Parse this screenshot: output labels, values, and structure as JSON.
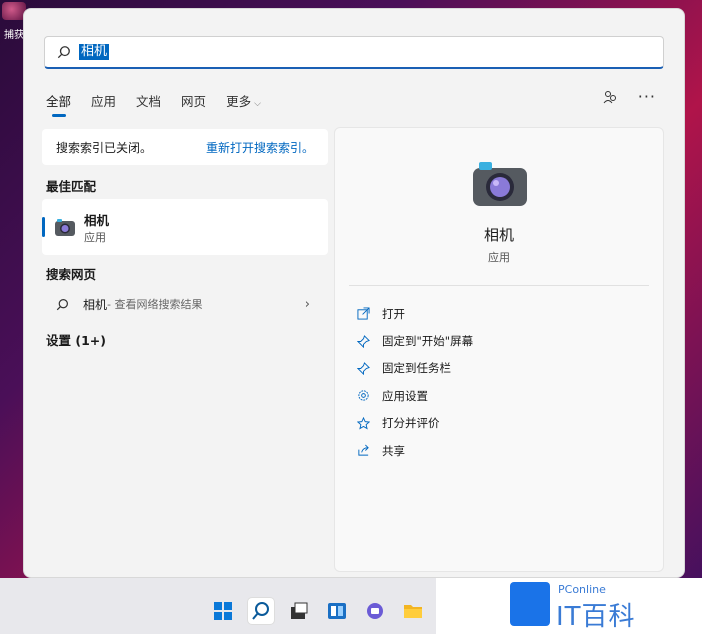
{
  "desktop": {
    "icon_label": "捕获"
  },
  "search": {
    "query": "相机"
  },
  "tabs": [
    {
      "label": "全部",
      "active": true
    },
    {
      "label": "应用"
    },
    {
      "label": "文档"
    },
    {
      "label": "网页"
    },
    {
      "label": "更多"
    }
  ],
  "notice": {
    "text": "搜索索引已关闭。",
    "link": "重新打开搜索索引。"
  },
  "sections": {
    "best_match": "最佳匹配",
    "web": "搜索网页",
    "settings": "设置 (1+)"
  },
  "best_match": {
    "name": "相机",
    "type": "应用"
  },
  "web_result": {
    "term": "相机",
    "suffix": " - 查看网络搜索结果"
  },
  "detail": {
    "name": "相机",
    "type": "应用",
    "actions": [
      {
        "label": "打开",
        "icon": "open-icon"
      },
      {
        "label": "固定到\"开始\"屏幕",
        "icon": "pin-icon"
      },
      {
        "label": "固定到任务栏",
        "icon": "pin-icon"
      },
      {
        "label": "应用设置",
        "icon": "gear-icon"
      },
      {
        "label": "打分并评价",
        "icon": "star-icon"
      },
      {
        "label": "共享",
        "icon": "share-icon"
      }
    ]
  },
  "watermark": {
    "small": "PConline",
    "big": "IT百科"
  },
  "colors": {
    "accent": "#0067c0"
  }
}
